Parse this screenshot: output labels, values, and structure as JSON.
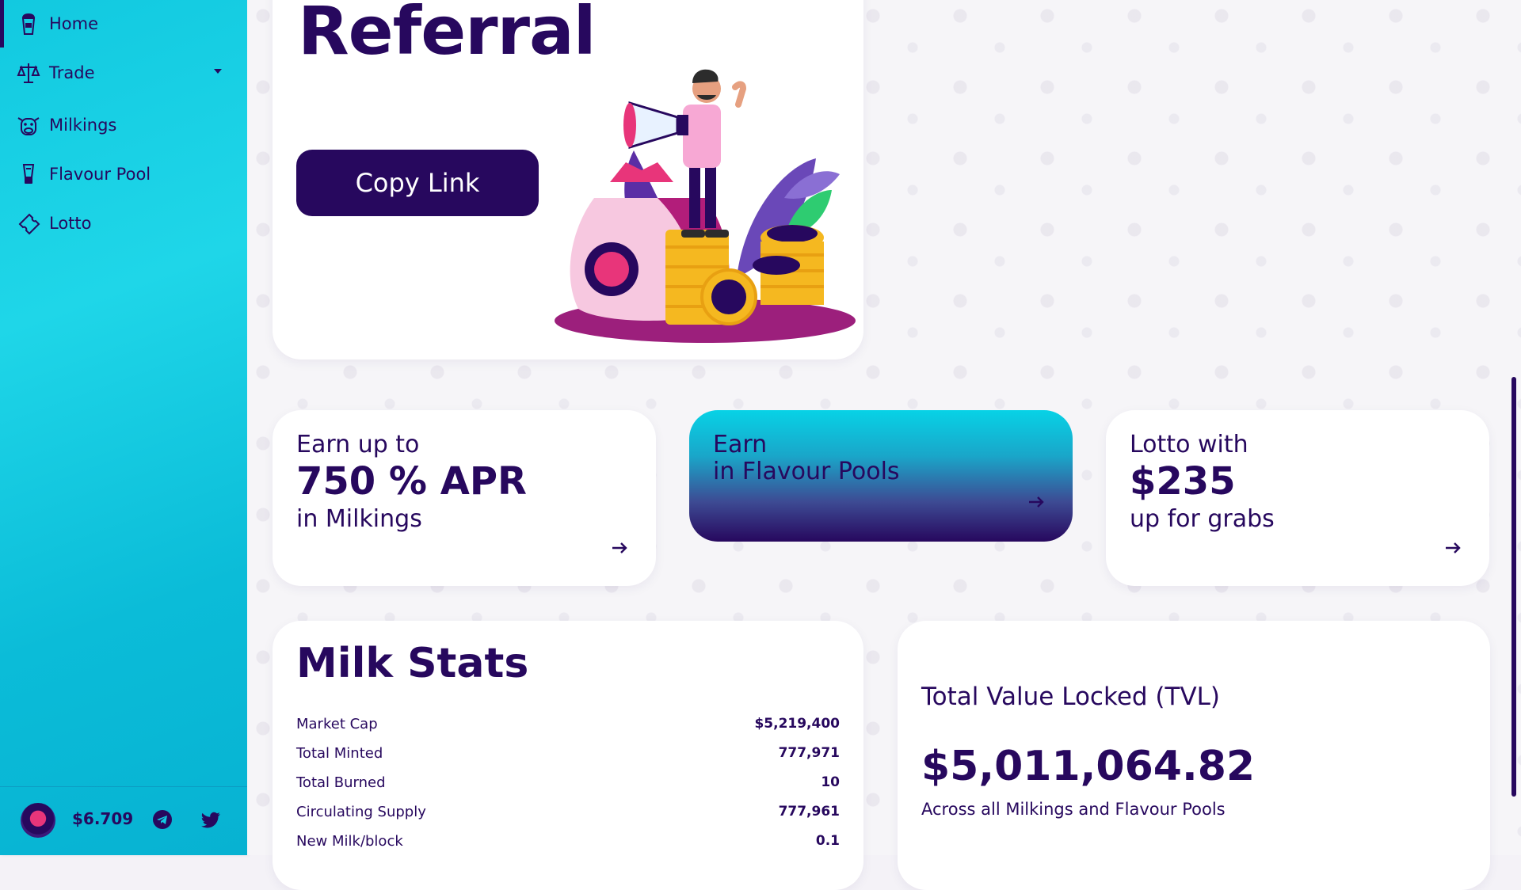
{
  "sidebar": {
    "items": [
      {
        "label": "Home",
        "icon": "milkshake-icon"
      },
      {
        "label": "Trade",
        "icon": "scales-icon"
      },
      {
        "label": "Milkings",
        "icon": "cow-icon"
      },
      {
        "label": "Flavour Pool",
        "icon": "blender-icon"
      },
      {
        "label": "Lotto",
        "icon": "ticket-icon"
      }
    ],
    "footer": {
      "price": "$6.709",
      "logo": "milk-token-logo",
      "social": [
        "telegram-icon",
        "twitter-icon"
      ]
    }
  },
  "referral": {
    "title": "Referral",
    "button": "Copy Link"
  },
  "earn_cards": {
    "milkings": {
      "line1": "Earn up to",
      "value": "750 % APR",
      "line3": "in Milkings"
    },
    "flavour": {
      "line1": "Earn",
      "line2": "in Flavour Pools"
    },
    "lotto": {
      "line1": "Lotto with",
      "value": "$235",
      "line3": "up for grabs"
    }
  },
  "milk_stats": {
    "title": "Milk Stats",
    "rows": [
      {
        "label": "Market Cap",
        "value": "$5,219,400"
      },
      {
        "label": "Total Minted",
        "value": "777,971"
      },
      {
        "label": "Total Burned",
        "value": "10"
      },
      {
        "label": "Circulating Supply",
        "value": "777,961"
      },
      {
        "label": "New Milk/block",
        "value": "0.1"
      }
    ]
  },
  "tvl": {
    "title": "Total Value Locked (TVL)",
    "value": "$5,011,064.82",
    "subtitle": "Across all Milkings and Flavour Pools"
  },
  "colors": {
    "primary": "#27085e",
    "sidebar": "#12c9e0",
    "accent_pink": "#e8357a",
    "gold": "#f5b820"
  }
}
